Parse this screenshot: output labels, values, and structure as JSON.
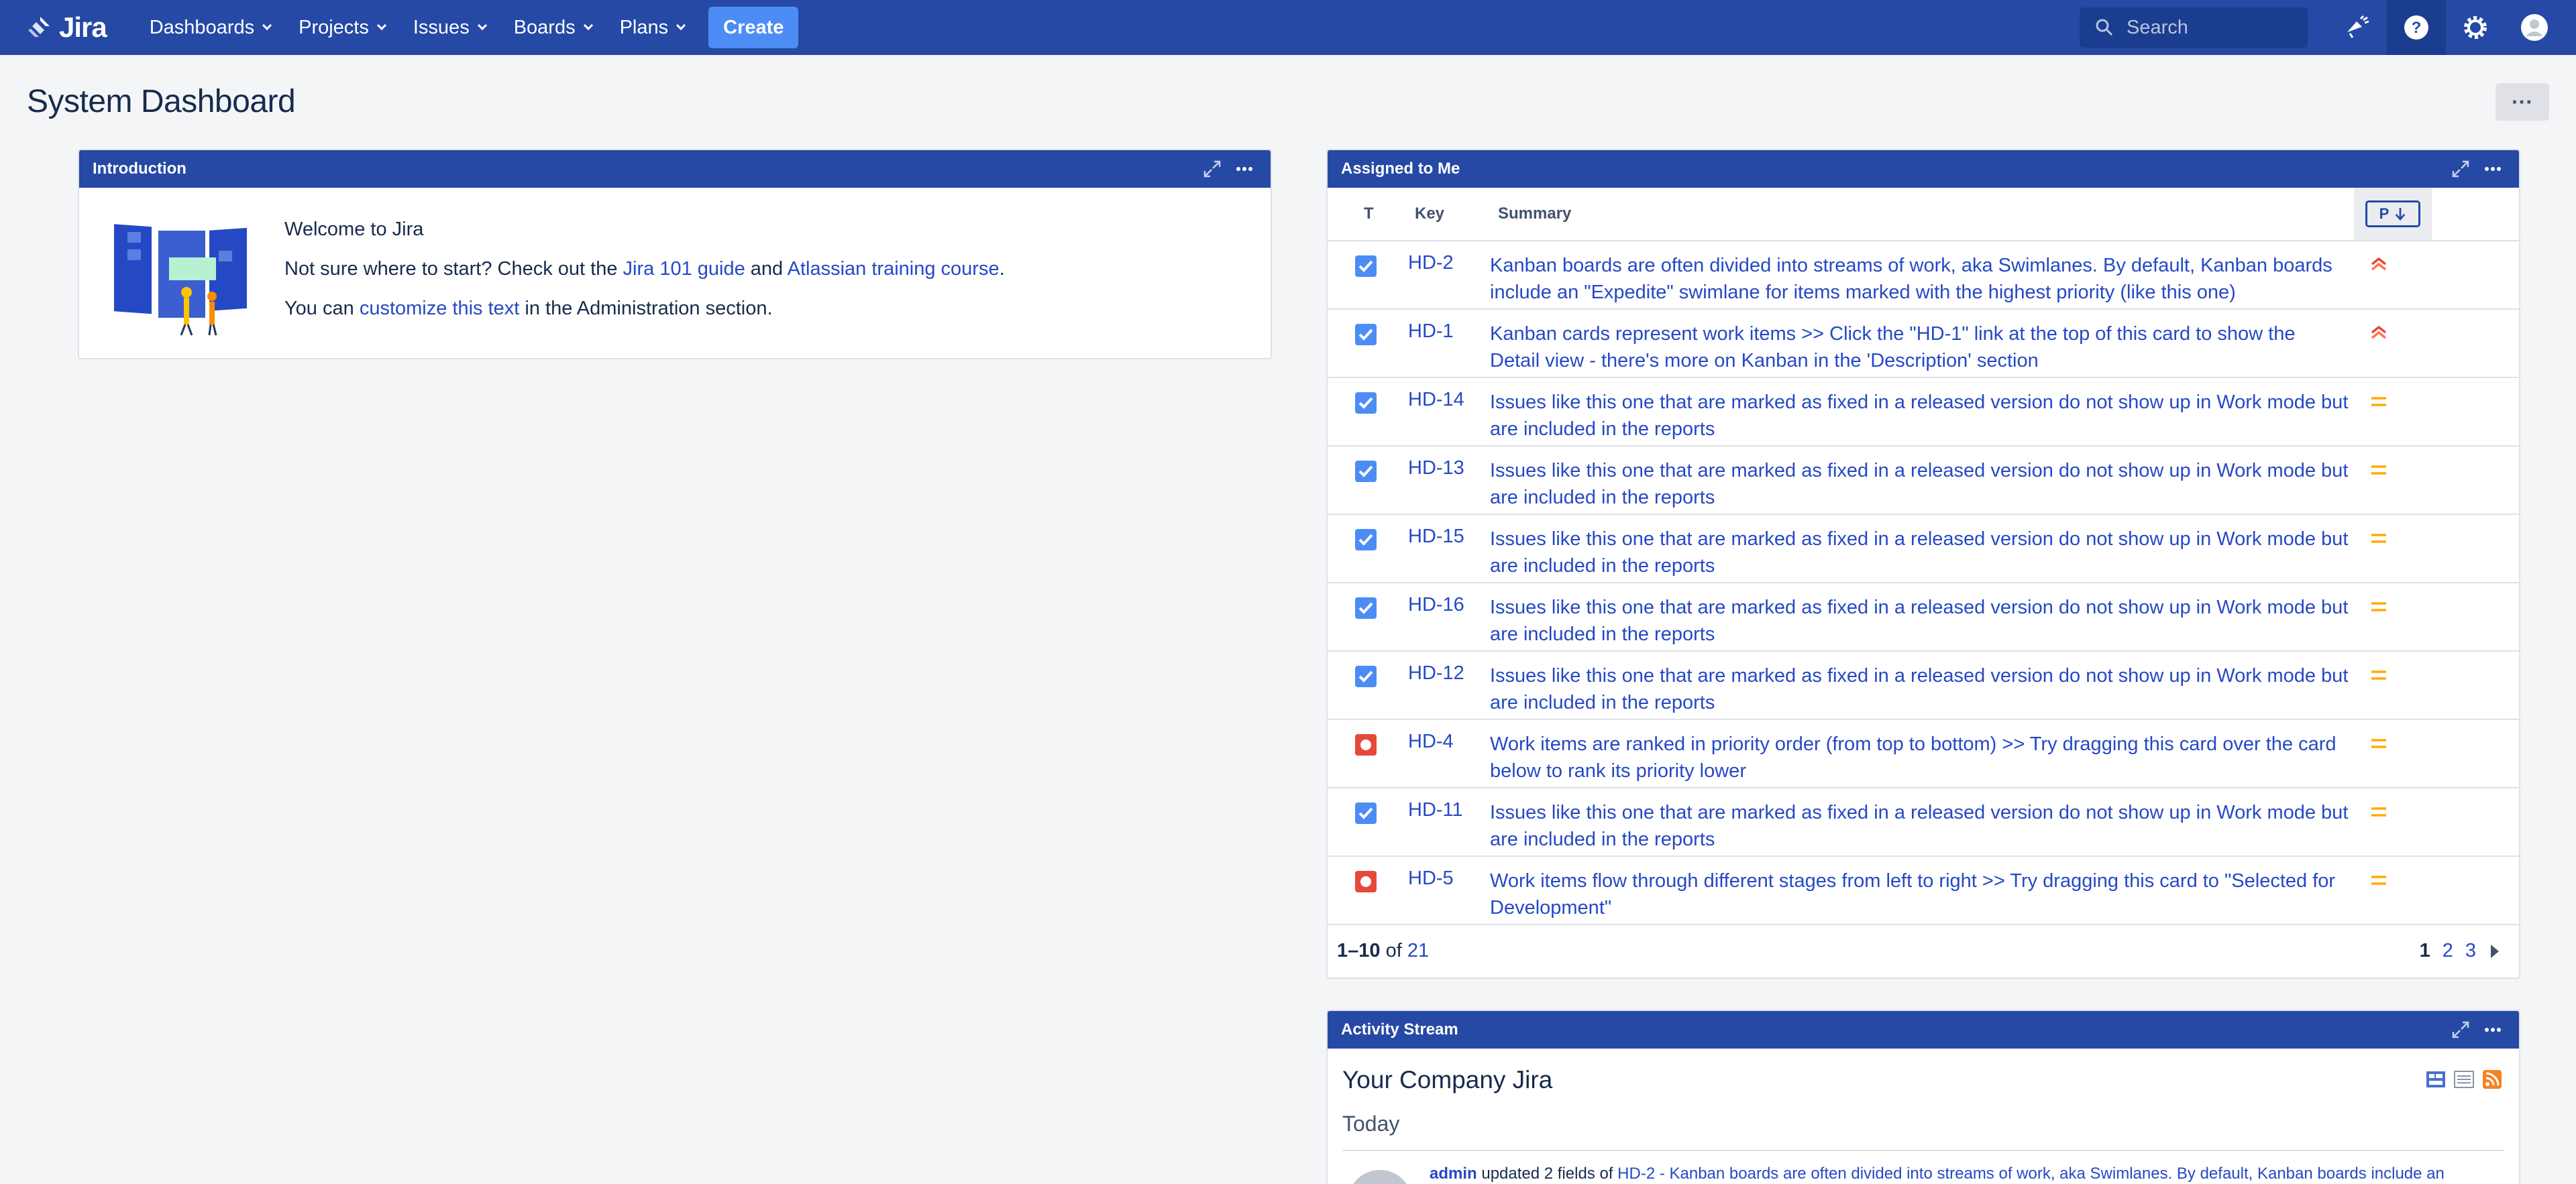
{
  "nav": {
    "logo_text": "Jira",
    "menu": [
      {
        "label": "Dashboards"
      },
      {
        "label": "Projects"
      },
      {
        "label": "Issues"
      },
      {
        "label": "Boards"
      },
      {
        "label": "Plans"
      }
    ],
    "create_label": "Create",
    "search_placeholder": "Search",
    "icons": [
      "notifications-icon",
      "help-icon",
      "settings-icon",
      "profile-icon"
    ],
    "bar_color": "#2549a5"
  },
  "page": {
    "title": "System Dashboard",
    "more_label": "···"
  },
  "intro": {
    "title": "Introduction",
    "welcome": "Welcome to Jira",
    "line2_prefix": "Not sure where to start? Check out the ",
    "line2_link1": "Jira 101 guide",
    "line2_and": " and ",
    "line2_link2": "Atlassian training course",
    "line2_suffix": ".",
    "line3_prefix": "You can ",
    "line3_link": "customize this text",
    "line3_suffix": " in the Administration section."
  },
  "assigned": {
    "title": "Assigned to Me",
    "columns": {
      "type": "T",
      "key": "Key",
      "summary": "Summary",
      "priority": "P"
    },
    "rows": [
      {
        "type": "task",
        "key": "HD-2",
        "summary": "Kanban boards are often divided into streams of work, aka Swimlanes. By default, Kanban boards include an \"Expedite\" swimlane for items marked with the highest priority (like this one)",
        "priority": "highest"
      },
      {
        "type": "task",
        "key": "HD-1",
        "summary": "Kanban cards represent work items >> Click the \"HD-1\" link at the top of this card to show the Detail view - there's more on Kanban in the 'Description' section",
        "priority": "highest"
      },
      {
        "type": "task",
        "key": "HD-14",
        "summary": "Issues like this one that are marked as fixed in a released version do not show up in Work mode but are included in the reports",
        "priority": "medium"
      },
      {
        "type": "task",
        "key": "HD-13",
        "summary": "Issues like this one that are marked as fixed in a released version do not show up in Work mode but are included in the reports",
        "priority": "medium"
      },
      {
        "type": "task",
        "key": "HD-15",
        "summary": "Issues like this one that are marked as fixed in a released version do not show up in Work mode but are included in the reports",
        "priority": "medium"
      },
      {
        "type": "task",
        "key": "HD-16",
        "summary": "Issues like this one that are marked as fixed in a released version do not show up in Work mode but are included in the reports",
        "priority": "medium"
      },
      {
        "type": "task",
        "key": "HD-12",
        "summary": "Issues like this one that are marked as fixed in a released version do not show up in Work mode but are included in the reports",
        "priority": "medium"
      },
      {
        "type": "bug",
        "key": "HD-4",
        "summary": "Work items are ranked in priority order (from top to bottom) >> Try dragging this card over the card below to rank its priority lower",
        "priority": "medium"
      },
      {
        "type": "task",
        "key": "HD-11",
        "summary": "Issues like this one that are marked as fixed in a released version do not show up in Work mode but are included in the reports",
        "priority": "medium"
      },
      {
        "type": "bug",
        "key": "HD-5",
        "summary": "Work items flow through different stages from left to right >> Try dragging this card to \"Selected for Development\"",
        "priority": "medium"
      }
    ],
    "footer": {
      "range": "1–10",
      "of": "of",
      "total": "21"
    },
    "pages": [
      "1",
      "2",
      "3"
    ]
  },
  "activity": {
    "title": "Activity Stream",
    "company": "Your Company Jira",
    "today": "Today",
    "item": {
      "user": "admin",
      "action": " updated 2 fields of ",
      "link": "HD-2 - Kanban boards are often divided into streams of work, aka Swimlanes. By default, Kanban boards include an"
    }
  }
}
